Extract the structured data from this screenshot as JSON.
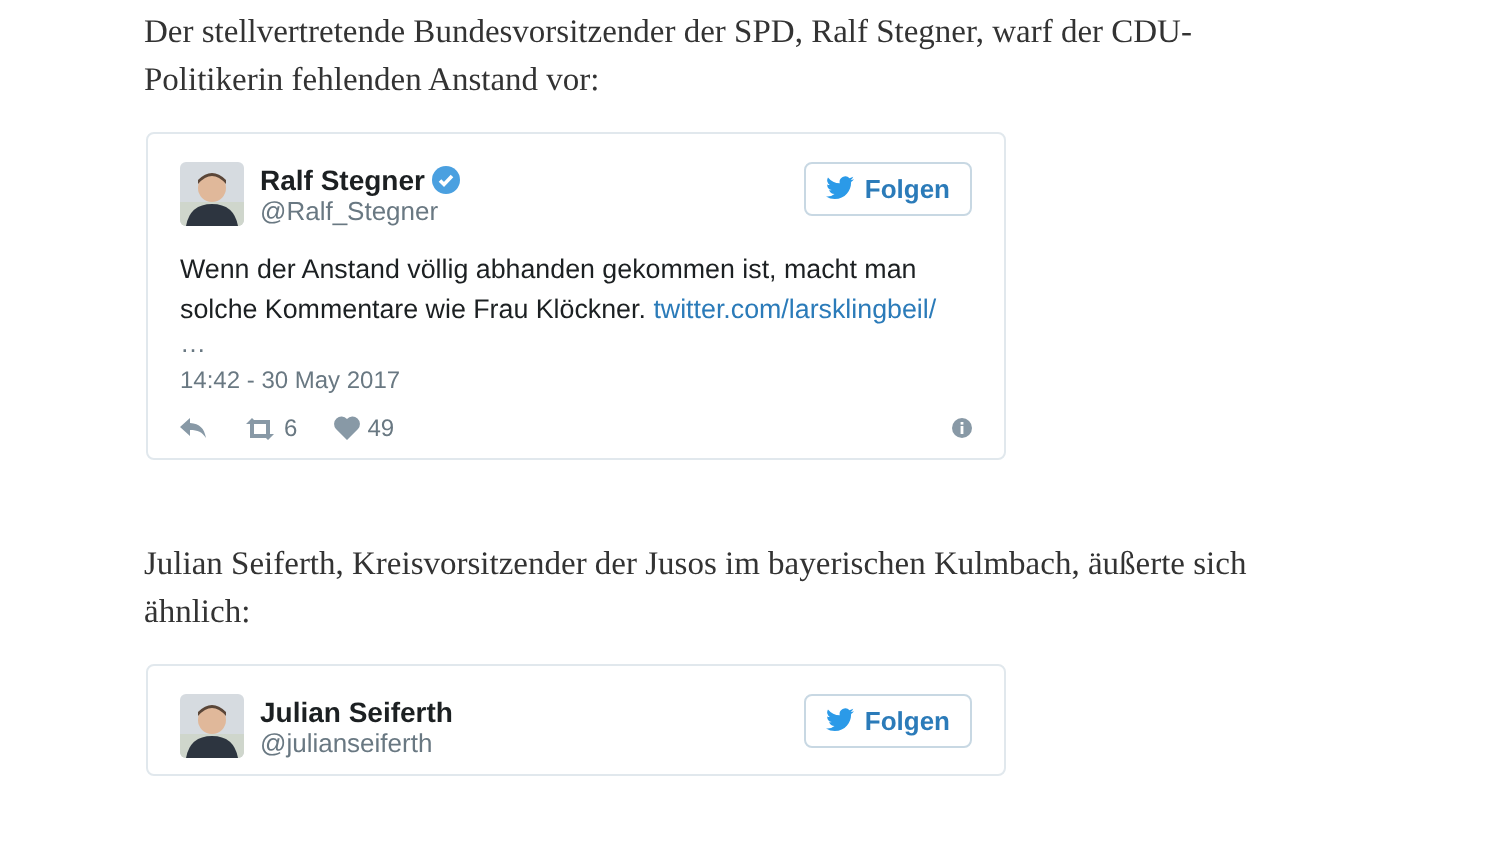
{
  "article": [
    {
      "kind": "paragraph",
      "text": "Der stellvertretende Bundesvorsitzender der SPD, Ralf Stegner, warf der CDU-Politikerin fehlenden Anstand vor:"
    },
    {
      "kind": "tweet",
      "name": "Ralf Stegner",
      "verified": true,
      "handle": "@Ralf_Stegner",
      "follow": "Folgen",
      "text": "Wenn der Anstand völlig abhanden gekommen ist, macht man solche Kommentare wie Frau Klöckner.",
      "link": "twitter.com/larsklingbeil/",
      "ellipsis": "…",
      "time": "14:42 - 30 May 2017",
      "retweets": "6",
      "likes": "49"
    },
    {
      "kind": "paragraph",
      "text": "Julian Seiferth, Kreisvorsitzender der Jusos im bayerischen Kulmbach, äußerte sich ähnlich:"
    },
    {
      "kind": "tweet",
      "name": "Julian Seiferth",
      "verified": false,
      "handle": "@julianseiferth",
      "follow": "Folgen"
    }
  ]
}
